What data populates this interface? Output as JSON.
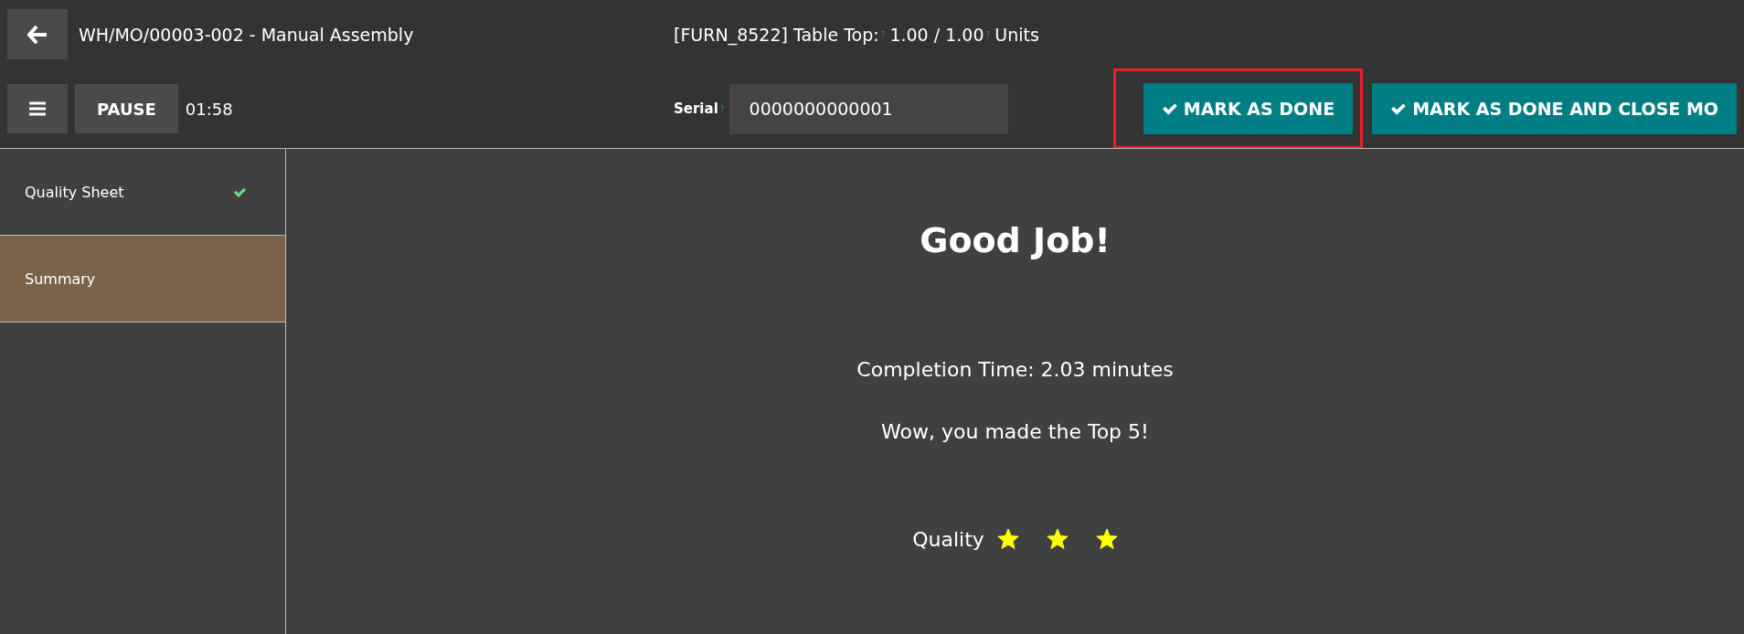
{
  "header": {
    "title": "WH/MO/00003-002 - Manual Assembly",
    "product": "[FURN_8522] Table Top:",
    "product_hint": "?",
    "quantity": "1.00 / 1.00",
    "unit_hint": "?",
    "unit": "Units"
  },
  "toolbar": {
    "pause": "PAUSE",
    "timer": "01:58",
    "serial_label": "Serial",
    "serial_hint": "?",
    "serial_value": "0000000000001",
    "actions": [
      {
        "label": "MARK AS DONE",
        "highlighted": true
      },
      {
        "label": "MARK AS DONE AND CLOSE MO",
        "highlighted": false
      }
    ]
  },
  "steps": [
    {
      "label": "Quality Sheet",
      "selected": false,
      "done": true
    },
    {
      "label": "Summary",
      "selected": true,
      "done": false
    }
  ],
  "summary": {
    "title": "Good Job!",
    "completion": "Completion Time: 2.03 minutes",
    "rank": "Wow, you made the Top 5!",
    "quality_label": "Quality",
    "stars": 3
  }
}
